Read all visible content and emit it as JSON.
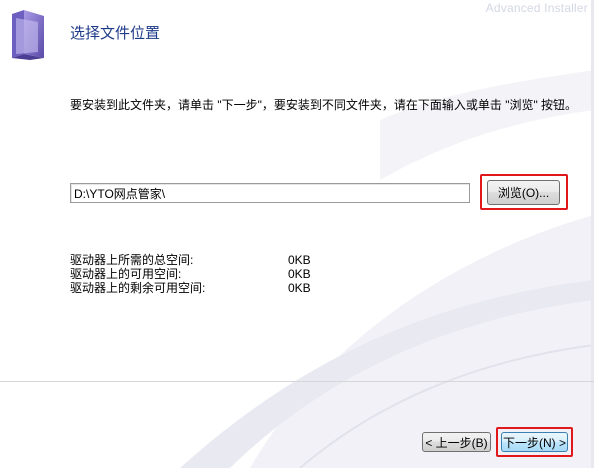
{
  "window": {
    "watermark": "Advanced Installer",
    "title": "选择文件位置"
  },
  "instruction": "要安装到此文件夹，请单击 \"下一步\"，要安装到不同文件夹，请在下面输入或单击 \"浏览\" 按钮。",
  "path_field": {
    "value": "D:\\YTO网点管家\\"
  },
  "browse_button": {
    "label": "浏览(O)..."
  },
  "space_info": [
    {
      "label": "驱动器上所需的总空间:",
      "value": "0KB"
    },
    {
      "label": "驱动器上的可用空间:",
      "value": "0KB"
    },
    {
      "label": "驱动器上的剩余可用空间:",
      "value": "0KB"
    }
  ],
  "footer": {
    "back_label": "< 上一步(B)",
    "next_label": "下一步(N) >"
  },
  "colors": {
    "title": "#1f3a8a",
    "highlight": "#e0181c",
    "folder": "#7b6fc4"
  },
  "icons": {
    "header": "folder-icon"
  }
}
